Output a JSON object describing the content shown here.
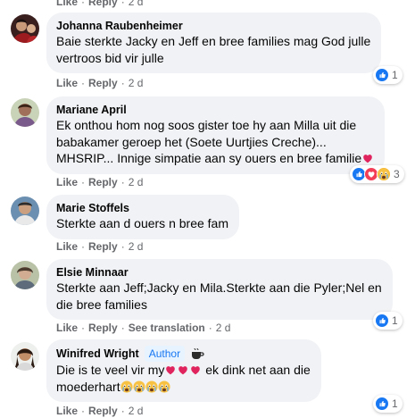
{
  "labels": {
    "like": "Like",
    "reply": "Reply",
    "see_translation": "See translation",
    "author": "Author",
    "sep": "·"
  },
  "top_meta": {
    "time": "2 d"
  },
  "comments": [
    {
      "name": "Johanna Raubenheimer",
      "lines": [
        "Baie sterkte Jacky en Jeff en bree families mag God julle",
        "vertroos bid vir julle"
      ],
      "time": "2 d",
      "reaction_count": "1"
    },
    {
      "name": "Mariane April",
      "lines": [
        "Ek onthou hom nog soos gister toe hy aan Milla uit die",
        "babakamer geroep het (Soete Uurtjies Creche)...",
        "MHSRIP... Innige simpatie aan sy ouers en bree familie"
      ],
      "time": "2 d",
      "reaction_count": "3"
    },
    {
      "name": "Marie Stoffels",
      "lines": [
        "Sterkte aan d ouers n bree fam"
      ],
      "time": "2 d"
    },
    {
      "name": "Elsie Minnaar",
      "lines": [
        "Sterkte aan Jeff;Jacky en Mila.Sterkte aan die Pyler;Nel en",
        "die bree families"
      ],
      "time": "2 d",
      "reaction_count": "1"
    },
    {
      "name": "Winifred Wright",
      "lines": [
        "Die is te veel vir my",
        "ek dink net aan die",
        "moederhart"
      ],
      "time": "2 d",
      "reaction_count": "1"
    }
  ],
  "colors": {
    "link": "#65676b",
    "bubble": "#f0f2f5",
    "like": "#1877f2",
    "love": "#f33e58",
    "sad": "#f7b125"
  }
}
